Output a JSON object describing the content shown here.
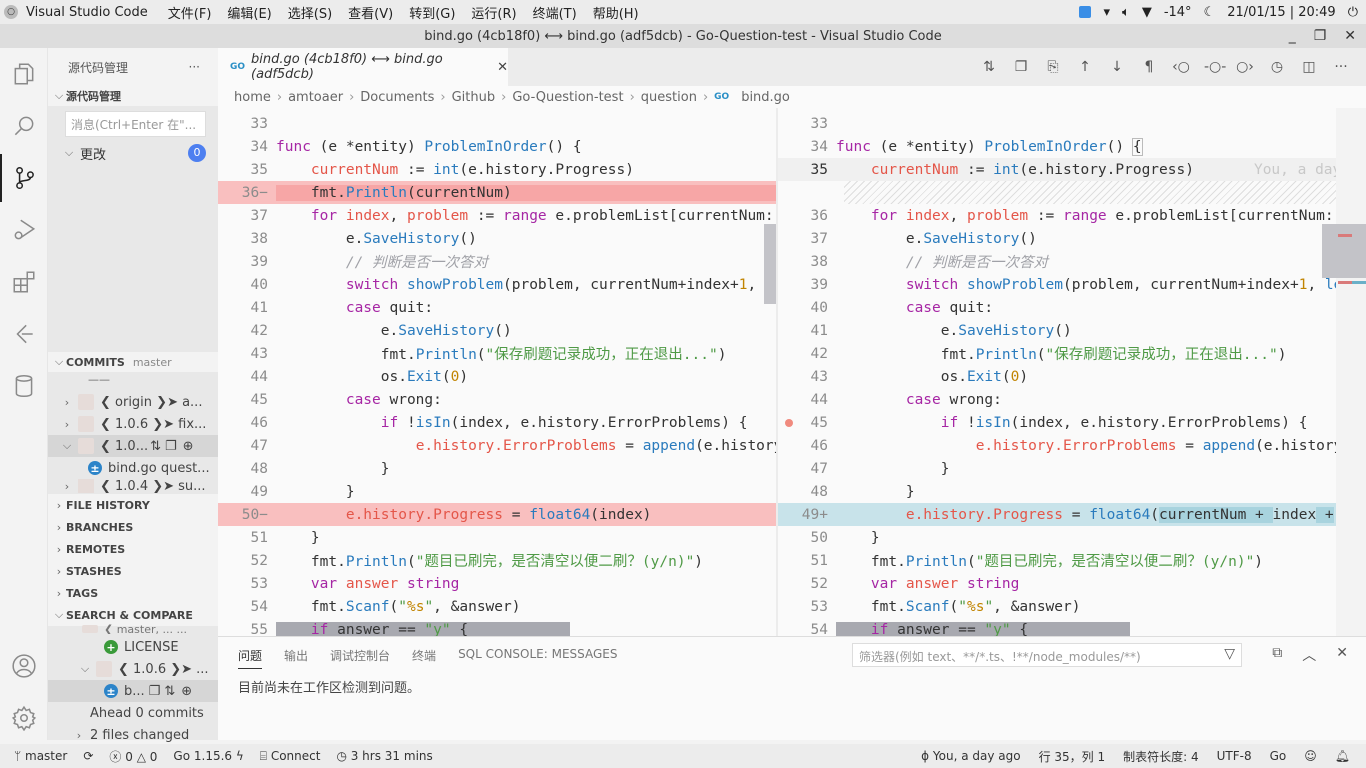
{
  "system_bar": {
    "app_name": "Visual Studio Code",
    "menus": [
      "文件(F)",
      "编辑(E)",
      "选择(S)",
      "查看(V)",
      "转到(G)",
      "运行(R)",
      "终端(T)",
      "帮助(H)"
    ],
    "weather": "-14°",
    "datetime": "21/01/15 | 20:49"
  },
  "window": {
    "title": "bind.go (4cb18f0) ⟷ bind.go (adf5dcb) - Go-Question-test - Visual Studio Code",
    "minimize": "_",
    "restore": "❐",
    "close": "✕"
  },
  "activity_bar": [
    "explorer-icon",
    "search-icon",
    "source-control-icon",
    "run-debug-icon",
    "extensions-icon",
    "gitlens-icon",
    "database-icon",
    "account-icon",
    "settings-gear-icon"
  ],
  "sidebar": {
    "title": "源代码管理",
    "more": "···",
    "section": "源代码管理",
    "message_placeholder": "消息(Ctrl+Enter 在\"...",
    "changes_label": "更改",
    "changes_count": "0",
    "commits": {
      "header": "COMMITS",
      "branch": "master",
      "separator": "——",
      "items": [
        {
          "label": "❮ origin ❯➤ a...",
          "expanded": false
        },
        {
          "label": "❮ 1.0.6 ❯➤ fix...",
          "expanded": false
        },
        {
          "label": "❮ 1.0...",
          "expanded": true
        },
        {
          "label": "bind.go  quest...",
          "file": true
        },
        {
          "label": "❮ 1.0.4 ❯➤ su...",
          "expanded": false
        }
      ]
    },
    "sections": [
      "FILE HISTORY",
      "BRANCHES",
      "REMOTES",
      "STASHES",
      "TAGS",
      "SEARCH & COMPARE"
    ],
    "search_compare": {
      "items": [
        {
          "label": "❮ master, ... ..."
        },
        {
          "label": "LICENSE",
          "file": true
        },
        {
          "label": "❮ 1.0.6 ❯➤ ..."
        },
        {
          "label": "b...",
          "file": true
        }
      ],
      "ahead": "Ahead  0 commits",
      "files_changed": "2 files changed"
    }
  },
  "editor": {
    "tab_label": "bind.go (4cb18f0) ⟷ bind.go (adf5dcb)",
    "tab_close": "✕",
    "go_badge": "GO",
    "breadcrumb": [
      "home",
      "amtoaer",
      "Documents",
      "Github",
      "Go-Question-test",
      "question",
      "bind.go"
    ],
    "left_lines": [
      "33",
      "34",
      "35",
      "36−",
      "37",
      "38",
      "39",
      "40",
      "41",
      "42",
      "43",
      "44",
      "45",
      "46",
      "47",
      "48",
      "49",
      "50−",
      "51",
      "52",
      "53",
      "54",
      "55"
    ],
    "right_lines": [
      "33",
      "34",
      "35",
      "",
      "36",
      "37",
      "38",
      "39",
      "40",
      "41",
      "42",
      "43",
      "44",
      "45",
      "46",
      "47",
      "48",
      "49+",
      "50",
      "51",
      "52",
      "53",
      "54"
    ],
    "blame": "You, a day"
  },
  "panel": {
    "tabs": [
      "问题",
      "输出",
      "调试控制台",
      "终端",
      "SQL CONSOLE: MESSAGES"
    ],
    "filter_placeholder": "筛选器(例如 text、**/*.ts、!**/node_modules/**)",
    "message": "目前尚未在工作区检测到问题。"
  },
  "status_bar": {
    "branch": "master",
    "errors": "0",
    "warnings": "0",
    "go_version": "Go 1.15.6",
    "connect": "Connect",
    "time": "3 hrs 31 mins",
    "blame": "You, a day ago",
    "position": "行 35，列 1",
    "tab_size": "制表符长度: 4",
    "encoding": "UTF-8",
    "language": "Go"
  }
}
